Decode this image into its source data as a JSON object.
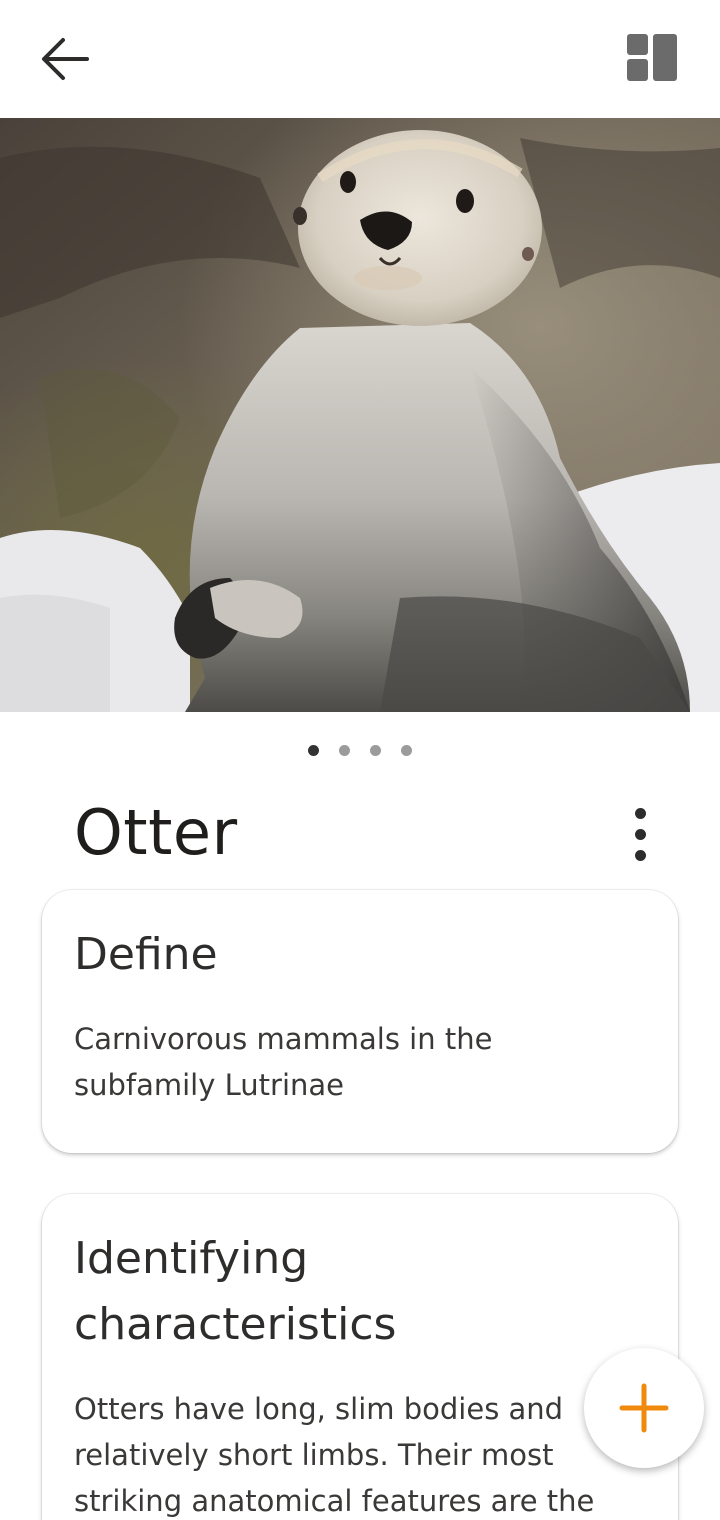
{
  "header": {
    "back_icon": "arrow-left-icon",
    "layout_icon": "dashboard-layout-icon"
  },
  "hero": {
    "image_subject": "otter",
    "pager": {
      "total": 4,
      "active_index": 0
    }
  },
  "animal": {
    "title": "Otter",
    "more_icon": "more-vertical-icon"
  },
  "cards": [
    {
      "title": "Define",
      "body": "Carnivorous mammals in the subfamily Lutrinae"
    },
    {
      "title": "Identifying characteristics",
      "body": "Otters have long, slim bodies and relatively short limbs. Their most striking anatomical features are the"
    }
  ],
  "fab": {
    "icon": "plus-icon",
    "color": "#f08a0c"
  },
  "colors": {
    "background": "#ffffff",
    "text": "#2b2a29",
    "accent": "#f08a0c"
  }
}
